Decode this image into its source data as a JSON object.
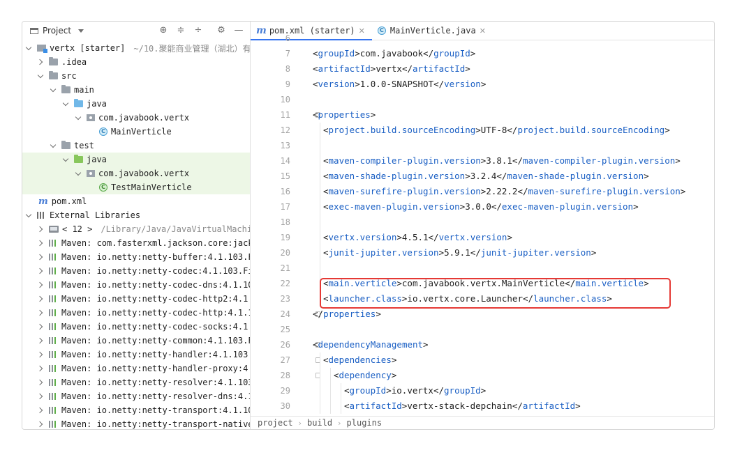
{
  "project_panel": {
    "title": "Project",
    "tree": [
      {
        "label": "vertx [starter]",
        "secondary": "~/10.聚能商业管理（湖北）有"
      },
      {
        "label": ".idea"
      },
      {
        "label": "src"
      },
      {
        "label": "main"
      },
      {
        "label": "java"
      },
      {
        "label": "com.javabook.vertx"
      },
      {
        "label": "MainVerticle"
      },
      {
        "label": "test"
      },
      {
        "label": "java"
      },
      {
        "label": "com.javabook.vertx"
      },
      {
        "label": "TestMainVerticle"
      },
      {
        "label": "pom.xml"
      },
      {
        "label": "External Libraries"
      },
      {
        "label": "< 12 >",
        "secondary": "/Library/Java/JavaVirtualMachin"
      },
      {
        "label": "Maven: com.fasterxml.jackson.core:jacks"
      },
      {
        "label": "Maven: io.netty:netty-buffer:4.1.103.F"
      },
      {
        "label": "Maven: io.netty:netty-codec:4.1.103.Fi"
      },
      {
        "label": "Maven: io.netty:netty-codec-dns:4.1.10"
      },
      {
        "label": "Maven: io.netty:netty-codec-http2:4.1."
      },
      {
        "label": "Maven: io.netty:netty-codec-http:4.1.1"
      },
      {
        "label": "Maven: io.netty:netty-codec-socks:4.1."
      },
      {
        "label": "Maven: io.netty:netty-common:4.1.103.F"
      },
      {
        "label": "Maven: io.netty:netty-handler:4.1.103."
      },
      {
        "label": "Maven: io.netty:netty-handler-proxy:4."
      },
      {
        "label": "Maven: io.netty:netty-resolver:4.1.103"
      },
      {
        "label": "Maven: io.netty:netty-resolver-dns:4.1"
      },
      {
        "label": "Maven: io.netty:netty-transport:4.1.10"
      },
      {
        "label": "Maven: io.netty:netty-transport-native"
      }
    ]
  },
  "editor": {
    "tabs": [
      {
        "label": "pom.xml (starter)",
        "icon": "maven-icon",
        "active": true
      },
      {
        "label": "MainVerticle.java",
        "icon": "java-class-icon",
        "active": false
      }
    ],
    "lines": [
      {
        "n": "6",
        "code": ""
      },
      {
        "n": "7",
        "code": "<groupId>com.javabook</groupId>"
      },
      {
        "n": "8",
        "code": "<artifactId>vertx</artifactId>"
      },
      {
        "n": "9",
        "code": "<version>1.0.0-SNAPSHOT</version>"
      },
      {
        "n": "10",
        "code": ""
      },
      {
        "n": "11",
        "code": "<properties>"
      },
      {
        "n": "12",
        "code": "  <project.build.sourceEncoding>UTF-8</project.build.sourceEncoding>"
      },
      {
        "n": "13",
        "code": ""
      },
      {
        "n": "14",
        "code": "  <maven-compiler-plugin.version>3.8.1</maven-compiler-plugin.version>"
      },
      {
        "n": "15",
        "code": "  <maven-shade-plugin.version>3.2.4</maven-shade-plugin.version>"
      },
      {
        "n": "16",
        "code": "  <maven-surefire-plugin.version>2.22.2</maven-surefire-plugin.version>"
      },
      {
        "n": "17",
        "code": "  <exec-maven-plugin.version>3.0.0</exec-maven-plugin.version>"
      },
      {
        "n": "18",
        "code": ""
      },
      {
        "n": "19",
        "code": "  <vertx.version>4.5.1</vertx.version>"
      },
      {
        "n": "20",
        "code": "  <junit-jupiter.version>5.9.1</junit-jupiter.version>"
      },
      {
        "n": "21",
        "code": ""
      },
      {
        "n": "22",
        "code": "  <main.verticle>com.javabook.vertx.MainVerticle</main.verticle>"
      },
      {
        "n": "23",
        "code": "  <launcher.class>io.vertx.core.Launcher</launcher.class>"
      },
      {
        "n": "24",
        "code": "</properties>"
      },
      {
        "n": "25",
        "code": ""
      },
      {
        "n": "26",
        "code": "<dependencyManagement>"
      },
      {
        "n": "27",
        "code": "  <dependencies>"
      },
      {
        "n": "28",
        "code": "    <dependency>"
      },
      {
        "n": "29",
        "code": "      <groupId>io.vertx</groupId>"
      },
      {
        "n": "30",
        "code": "      <artifactId>vertx-stack-depchain</artifactId>"
      }
    ],
    "breadcrumb": [
      "project",
      "build",
      "plugins"
    ]
  },
  "colors": {
    "tag": "#1a5fc4",
    "highlight_border": "#e53935",
    "test_row_bg": "#edf7e6",
    "active_tab_underline": "#3574f0"
  }
}
